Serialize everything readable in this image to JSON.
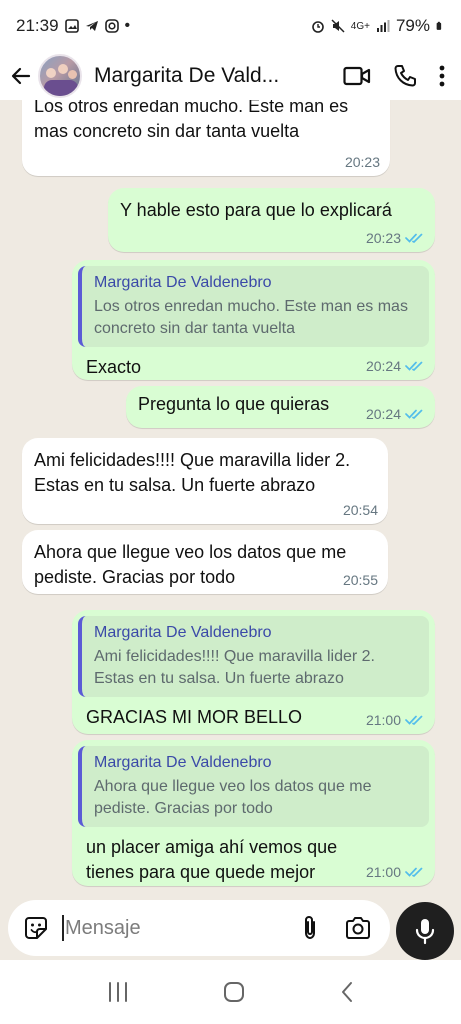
{
  "status_bar": {
    "time": "21:39",
    "battery": "79%",
    "network": "4G+"
  },
  "header": {
    "contact_name": "Margarita De Valdenebro",
    "contact_name_display": "Margarita De Vald..."
  },
  "messages": [
    {
      "direction": "in",
      "text": "Los otros enredan mucho. Este man es mas concreto sin dar tanta vuelta",
      "time": "20:23"
    },
    {
      "direction": "out",
      "text": "Y hable esto para que lo explicará",
      "time": "20:23",
      "status": "read"
    },
    {
      "direction": "out",
      "quote": {
        "author": "Margarita De Valdenebro",
        "text": "Los otros enredan mucho. Este man es mas concreto sin dar tanta vuelta"
      },
      "text": "Exacto",
      "time": "20:24",
      "status": "read"
    },
    {
      "direction": "out",
      "text": "Pregunta lo que quieras",
      "time": "20:24",
      "status": "read"
    },
    {
      "direction": "in",
      "text": "Ami felicidades!!!! Que maravilla lider 2. Estas en tu salsa. Un fuerte abrazo",
      "time": "20:54"
    },
    {
      "direction": "in",
      "text": "Ahora que llegue veo los datos que me pediste. Gracias por todo",
      "time": "20:55"
    },
    {
      "direction": "out",
      "quote": {
        "author": "Margarita De Valdenebro",
        "text": "Ami felicidades!!!! Que maravilla lider 2. Estas en tu salsa. Un fuerte abrazo"
      },
      "text": "GRACIAS MI MOR BELLO",
      "time": "21:00",
      "status": "read"
    },
    {
      "direction": "out",
      "quote": {
        "author": "Margarita De Valdenebro",
        "text": "Ahora que llegue veo los datos que me pediste. Gracias por todo"
      },
      "text": "un placer amiga ahí vemos que tienes para que quede mejor",
      "time": "21:00",
      "status": "read"
    }
  ],
  "composer": {
    "placeholder": "Mensaje"
  },
  "colors": {
    "chat_background": "#efeae2",
    "incoming_bubble": "#ffffff",
    "outgoing_bubble": "#d9fdd3",
    "read_ticks": "#53bdeb",
    "quote_bar": "#5b5bd6"
  }
}
